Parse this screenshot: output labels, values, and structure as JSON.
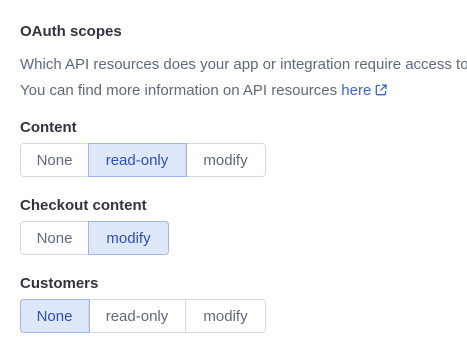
{
  "section": {
    "title": "OAuth scopes",
    "description_line1": "Which API resources does your app or integration require access to?",
    "description_line2": "You can find more information on API resources ",
    "link_text": "here",
    "link_icon": "external-link-icon"
  },
  "colors": {
    "accent": "#3c64d6",
    "selected_bg": "#dfe8fb",
    "selected_text": "#2c4fb8",
    "border": "#d4d9e1"
  },
  "scopes": [
    {
      "label": "Content",
      "options": [
        "None",
        "read-only",
        "modify"
      ],
      "selected": "read-only"
    },
    {
      "label": "Checkout content",
      "options": [
        "None",
        "modify"
      ],
      "selected": "modify"
    },
    {
      "label": "Customers",
      "options": [
        "None",
        "read-only",
        "modify"
      ],
      "selected": "None"
    }
  ]
}
